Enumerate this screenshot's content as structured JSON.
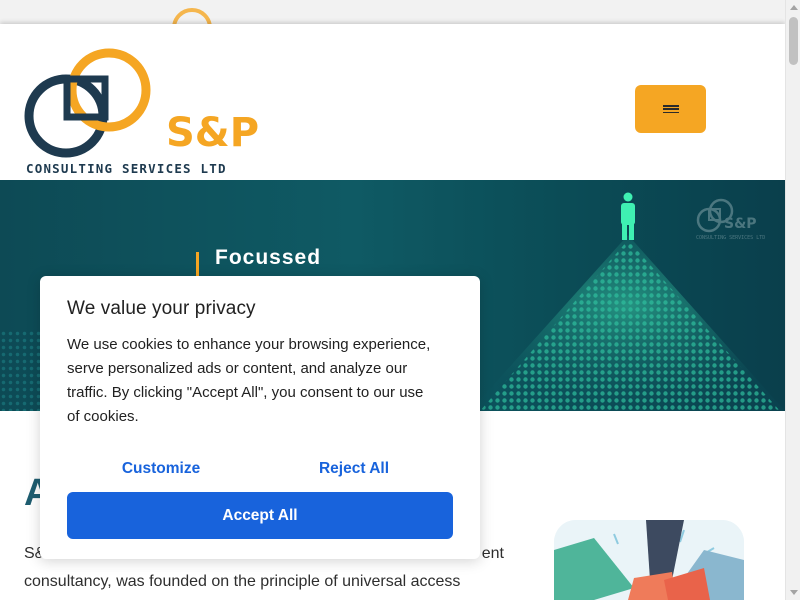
{
  "brand": {
    "name": "S&P",
    "tagline": "CONSULTING SERVICES LTD",
    "primary_color": "#1e3a4f",
    "accent_color": "#f5a623"
  },
  "header": {
    "menu_icon": "hamburger-menu-icon"
  },
  "hero": {
    "title": "Focussed",
    "logo_name": "S&P",
    "logo_tagline": "CONSULTING SERVICES LTD",
    "background_color": "#0f5a64"
  },
  "about": {
    "heading": "A",
    "paragraph_line1_start": "S&",
    "paragraph_line1_end": "ent",
    "paragraph_line2": "consultancy, was founded on the principle of universal access"
  },
  "cookie_banner": {
    "title": "We value your privacy",
    "body_lines": [
      "We use cookies to enhance your browsing experience,",
      "serve personalized ads or content, and analyze our",
      "traffic. By clicking \"Accept All\", you consent to our use",
      "of cookies."
    ],
    "customize_label": "Customize",
    "reject_label": "Reject All",
    "accept_label": "Accept All",
    "button_color": "#1863dc"
  },
  "scrollbar": {
    "up_icon": "scroll-up-arrow-icon",
    "down_icon": "scroll-down-arrow-icon"
  }
}
